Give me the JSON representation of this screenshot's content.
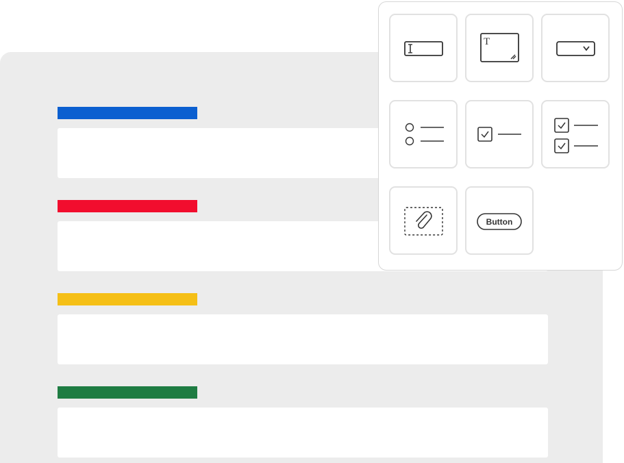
{
  "form": {
    "fields": [
      {
        "accent": "#0b5fd0"
      },
      {
        "accent": "#f20d2e"
      },
      {
        "accent": "#f5bf16"
      },
      {
        "accent": "#1e7c42"
      }
    ]
  },
  "palette": {
    "tiles": [
      {
        "icon": "text-input-icon"
      },
      {
        "icon": "textarea-icon",
        "glyph": "T"
      },
      {
        "icon": "dropdown-select-icon"
      },
      {
        "icon": "radio-list-icon"
      },
      {
        "icon": "checkbox-icon"
      },
      {
        "icon": "checkbox-list-icon"
      },
      {
        "icon": "file-upload-icon"
      },
      {
        "icon": "button-element-icon",
        "label": "Button"
      }
    ]
  },
  "colors": {
    "panel_bg": "#ececec",
    "icon_stroke": "#333333",
    "tile_border": "#e1e1e1"
  }
}
